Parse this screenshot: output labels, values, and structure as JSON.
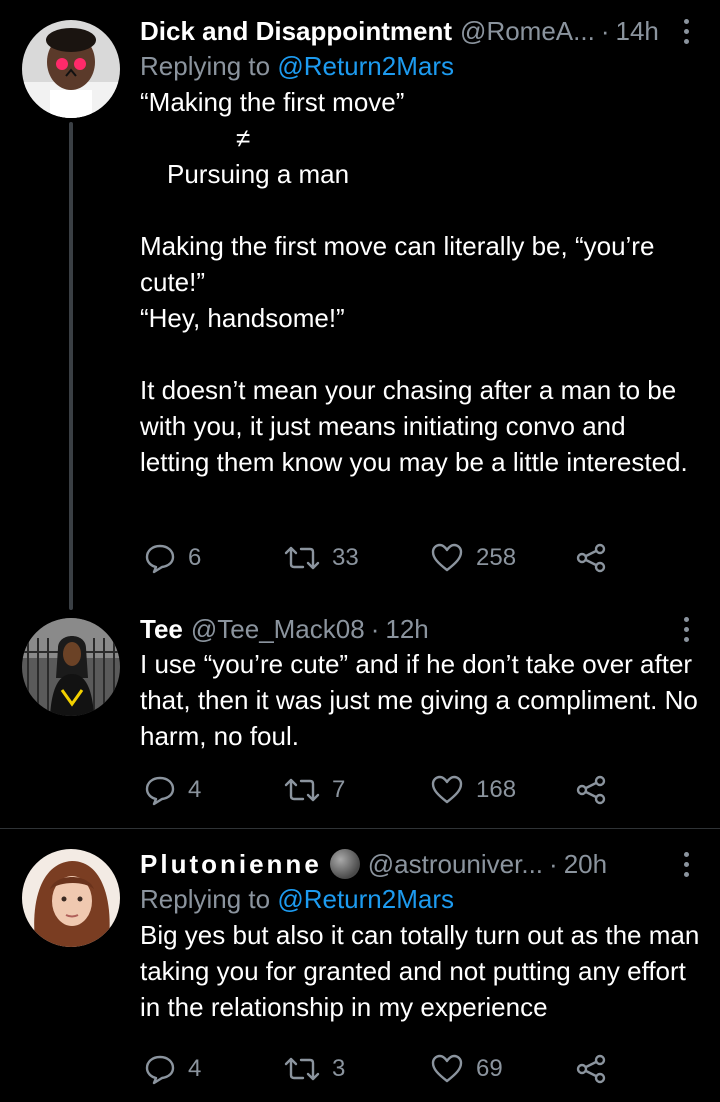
{
  "tweets": [
    {
      "name": "Dick and Disappointment",
      "handle": "@RomeA...",
      "dot": "·",
      "time": "14h",
      "replying_prefix": "Replying to ",
      "replying_to": "@Return2Mars",
      "text": {
        "l1": "“Making the first move”",
        "l2": "≠",
        "l3": "Pursuing a man",
        "l4": "Making the first move can literally be, “you’re cute!”",
        "l5": "“Hey, handsome!”",
        "l6": "It doesn’t mean your chasing after a man to be with you, it just means initiating convo and letting them know you may be a little interested."
      },
      "replies": "6",
      "retweets": "33",
      "likes": "258"
    },
    {
      "name": "Tee",
      "handle": "@Tee_Mack08",
      "dot": "·",
      "time": "12h",
      "text": "I use “you’re cute” and if he don’t take over after that, then it was just me giving a compliment. No harm, no foul.",
      "replies": "4",
      "retweets": "7",
      "likes": "168"
    },
    {
      "name": "Plutonienne",
      "handle": "@astrouniver...",
      "dot": "·",
      "time": "20h",
      "replying_prefix": "Replying to ",
      "replying_to": "@Return2Mars",
      "text": "Big yes but also it can totally turn out as the man taking you for granted and not putting any effort in the relationship in my experience",
      "replies": "4",
      "retweets": "3",
      "likes": "69"
    }
  ],
  "icons": {
    "reply": "reply-icon",
    "retweet": "retweet-icon",
    "like": "heart-icon",
    "share": "share-icon",
    "more": "more-options-icon"
  },
  "colors": {
    "background": "#000000",
    "text": "#ffffff",
    "secondary": "#8b949e",
    "link": "#1d9bf0",
    "divider": "#2f3336"
  }
}
